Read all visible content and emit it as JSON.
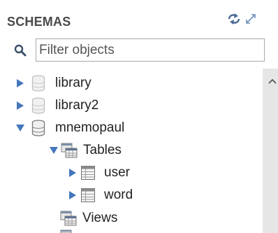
{
  "panel": {
    "title": "SCHEMAS",
    "header_icons": [
      "refresh-icon",
      "expand-icon"
    ]
  },
  "search": {
    "placeholder": "Filter objects",
    "value": ""
  },
  "tree": {
    "library": {
      "label": "library",
      "expanded": false
    },
    "library2": {
      "label": "library2",
      "expanded": false
    },
    "mnemopaul": {
      "label": "mnemopaul",
      "expanded": true,
      "tables": {
        "label": "Tables",
        "expanded": true,
        "items": [
          {
            "label": "user",
            "expanded": false
          },
          {
            "label": "word",
            "expanded": false
          }
        ]
      },
      "views": {
        "label": "Views"
      }
    }
  },
  "colors": {
    "accent": "#3a6fb0",
    "text": "#222222",
    "header_text": "#4a4a4a",
    "scrollbar": "#e6e6e6",
    "arrow": "#4477bb"
  }
}
